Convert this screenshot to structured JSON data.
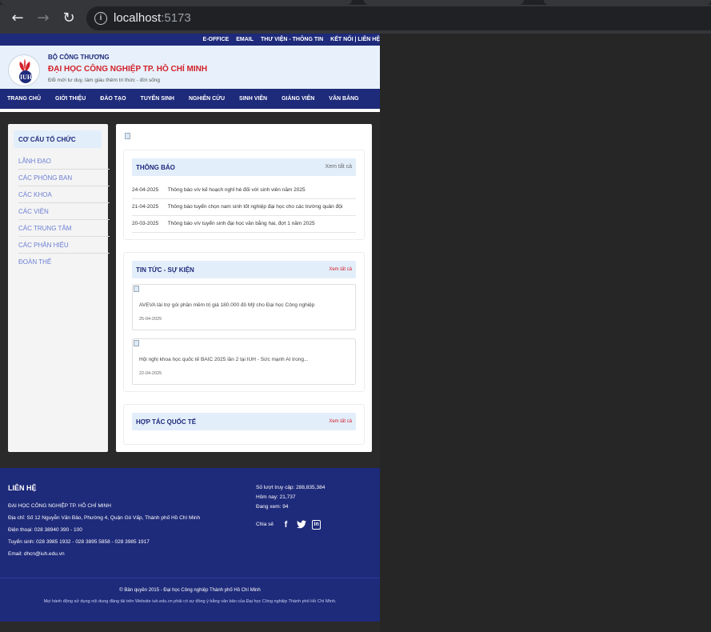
{
  "browser": {
    "back_icon": "arrow-left-icon",
    "forward_icon": "arrow-right-icon",
    "reload_icon": "reload-icon",
    "url_host": "localhost",
    "url_port": ":5173"
  },
  "topbar": {
    "links": [
      "E-OFFICE",
      "EMAIL",
      "THƯ VIỆN - THÔNG TIN",
      "KẾT NỐI | LIÊN HỆ"
    ]
  },
  "brand": {
    "ministry": "BỘ CÔNG THƯƠNG",
    "name": "ĐẠI HỌC CÔNG NGHIỆP TP. HỒ CHÍ MINH",
    "slogan": "Đổi mới tư duy, làm giàu thêm tri thức - đời sống",
    "logo_text": "IUH",
    "colors": {
      "primary": "#1e2a7a",
      "accent": "#d2202a"
    }
  },
  "nav": {
    "items": [
      "TRANG CHỦ",
      "GIỚI THIỆU",
      "ĐÀO TẠO",
      "TUYỂN SINH",
      "NGHIÊN CỨU",
      "SINH VIÊN",
      "GIẢNG VIÊN",
      "VĂN BẰNG"
    ]
  },
  "sidebar": {
    "heading": "CƠ CẤU TỔ CHỨC",
    "items": [
      "LÃNH ĐẠO",
      "CÁC PHÒNG BAN",
      "CÁC KHOA",
      "CÁC VIỆN",
      "CÁC TRUNG TÂM",
      "CÁC PHÂN HIỆU",
      "ĐOÀN THỂ"
    ]
  },
  "notices": {
    "title": "THÔNG BÁO",
    "more": "Xem tất cả",
    "rows": [
      {
        "date": "24-04-2025",
        "text": "Thông báo v/v kế hoạch nghỉ hè đối với sinh viên năm 2025"
      },
      {
        "date": "21-04-2025",
        "text": "Thông báo tuyển chọn nam sinh tốt nghiệp đại học cho các trường quân đội"
      },
      {
        "date": "20-03-2025",
        "text": "Thông báo v/v tuyển sinh đại học văn bằng hai, đợt 1 năm 2025"
      }
    ]
  },
  "news": {
    "title": "TIN TỨC - SỰ KIỆN",
    "more": "Xem tất cả",
    "items": [
      {
        "title": "AVEVA tài trợ gói phần mềm trị giá 180.000 đô Mỹ cho Đại học Công nghiệp",
        "date": "25-04-2025"
      },
      {
        "title": "Hội nghị khoa học quốc tế BAIC 2025 lần 2 tại IUH - Sức mạnh AI trong...",
        "date": "22-04-2025"
      }
    ]
  },
  "partners": {
    "title": "HỢP TÁC QUỐC TẾ",
    "more": "Xem tất cả"
  },
  "footer": {
    "heading": "LIÊN HỆ",
    "org": "ĐẠI HỌC CÔNG NGHIỆP TP. HỒ CHÍ MINH",
    "address": "Địa chỉ: Số 12 Nguyễn Văn Bảo, Phường 4, Quận Gò Vấp, Thành phố Hồ Chí Minh",
    "phone": "Điện thoại: 028 38940 390 - 100",
    "admission": "Tuyển sinh: 028 3985 1932 - 028 3895 5858 - 028 3985 1917",
    "email": "Email: dhcn@iuh.edu.vn",
    "visits": "Số lượt truy cập: 288,835,384",
    "today": "Hôm nay: 21,737",
    "online": "Đang xem: 94",
    "share": "Chia sẻ",
    "social_icons": [
      "facebook-icon",
      "twitter-icon",
      "linkedin-icon"
    ],
    "copyright": "© Bản quyền 2015 - Đại học Công nghiệp Thành phố Hồ Chí Minh",
    "notice": "Mọi hành động sử dụng nội dung đăng tải trên Website iuh.edu.vn phải có sự đồng ý bằng văn bản của Đại học Công nghiệp Thành phố Hồ Chí Minh."
  }
}
